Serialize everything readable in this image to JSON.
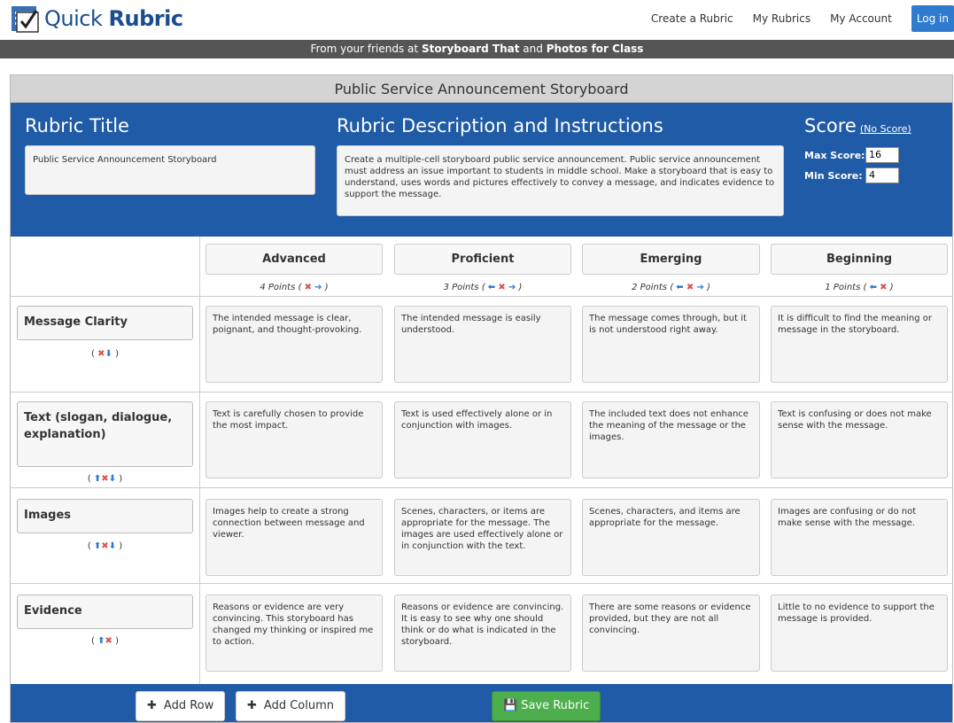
{
  "app": {
    "logo_quick": "Quick",
    "logo_rubric": "Rubric"
  },
  "nav": {
    "create": "Create a Rubric",
    "my_rubrics": "My Rubrics",
    "account": "My Account",
    "login": "Log in"
  },
  "banner": {
    "prefix": "From your friends at ",
    "brand1": "Storyboard That",
    "and": " and ",
    "brand2": "Photos for Class"
  },
  "card_title": "Public Service Announcement Storyboard",
  "header": {
    "title_label": "Rubric Title",
    "title_value": "Public Service Announcement Storyboard",
    "desc_label": "Rubric Description and Instructions",
    "desc_value": "Create a multiple-cell storyboard public service announcement. Public service announcement must address an issue important to students in middle school. Make a storyboard that is easy to understand, uses words and pictures effectively to convey a message, and indicates evidence to support the message.",
    "score_label": "Score",
    "no_score": "(No Score)",
    "max_label": "Max Score:",
    "max_value": "16",
    "min_label": "Min Score:",
    "min_value": "4"
  },
  "columns": [
    {
      "name": "Advanced",
      "points": "4 Points"
    },
    {
      "name": "Proficient",
      "points": "3 Points"
    },
    {
      "name": "Emerging",
      "points": "2 Points"
    },
    {
      "name": "Beginning",
      "points": "1 Points"
    }
  ],
  "rows": [
    {
      "name": "Message Clarity",
      "cells": [
        "The intended message is clear, poignant, and thought-provoking.",
        "The intended message is easily understood.",
        "The message comes through, but it is not understood right away.",
        "It is difficult to find the meaning or message in the storyboard."
      ]
    },
    {
      "name": "Text (slogan, dialogue, explanation)",
      "cells": [
        "Text is carefully chosen to provide the most impact.",
        "Text is used effectively alone or in conjunction with images.",
        "The included text does not enhance the meaning of the message or the images.",
        "Text is confusing or does not make sense with the message."
      ]
    },
    {
      "name": "Images",
      "cells": [
        "Images help to create a strong connection between message and viewer.",
        "Scenes, characters, or items are appropriate for the message. The images are used effectively alone or in conjunction with the text.",
        "Scenes, characters, and items are appropriate for the message.",
        "Images are confusing or do not make sense with the message."
      ]
    },
    {
      "name": "Evidence",
      "cells": [
        "Reasons or evidence are very convincing. This storyboard has changed my thinking or inspired me to action.",
        "Reasons or evidence are convincing. It is easy to see why one should think or do what is indicated in the storyboard.",
        "There are some reasons or evidence provided, but they are not all convincing.",
        "Little to no evidence to support the message is provided."
      ]
    }
  ],
  "footer": {
    "add_row": "Add Row",
    "add_column": "Add Column",
    "save": "Save Rubric"
  },
  "colors": {
    "blue": "#1f5ba6",
    "green": "#4cae4c",
    "red": "#d9534f",
    "arrow": "#2f7bd0"
  }
}
